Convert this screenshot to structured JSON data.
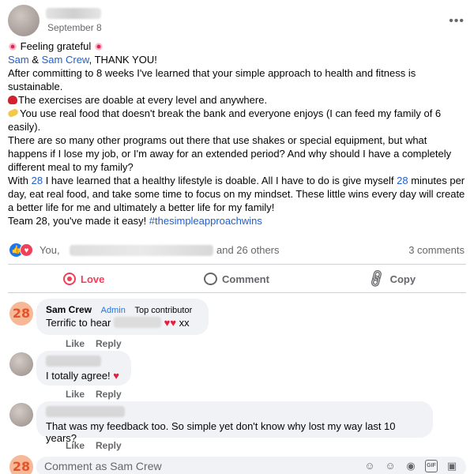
{
  "post": {
    "date": "September 8",
    "more_icon": "more-horizontal-icon",
    "lines": {
      "l1": "Feeling grateful",
      "l2_mention1": "Sam",
      "l2_amp": " & ",
      "l2_mention2": "Sam Crew",
      "l2_rest": ", THANK YOU!",
      "l3": "After committing to 8 weeks I've learned that your simple approach to health and fitness is sustainable.",
      "l4": "The exercises are doable at every level and anywhere.",
      "l5": "You use real food that doesn't break the bank and everyone enjoys (I can feed my family of 6 easily).",
      "l6": "There are so many other programs out there that use shakes or special equipment, but what happens if I lose my job, or I'm away for an extended period?  And why should I have a completely different meal to my family?",
      "l7_a": "With ",
      "l7_link": "28",
      "l7_b": " I have learned that a healthy lifestyle is doable.  All I have to do is give myself ",
      "l7_link2": "28",
      "l7_c": " minutes per day, eat real food, and take some time to focus on my mindset.  These little wins every day will create a better life for me and ultimately a better life for my family!",
      "l8_a": "Team 28, you've made it easy!  ",
      "l8_hashtag": "#thesimpleapproachwins"
    }
  },
  "reactions": {
    "you": "You,",
    "others": "and 26 others",
    "comments_count": "3 comments"
  },
  "actions": {
    "love": "Love",
    "comment": "Comment",
    "copy": "Copy"
  },
  "comments": [
    {
      "author": "Sam Crew",
      "role": "Admin",
      "badge": "Top contributor",
      "text_before": "Terrific to hear",
      "text_after": " xx",
      "hearts": "♥♥",
      "avatar_text": "28",
      "like": "Like",
      "reply": "Reply"
    },
    {
      "text": "I totally agree!",
      "heart": "♥",
      "like": "Like",
      "reply": "Reply"
    },
    {
      "text": "That was my feedback too. So simple yet don't know why lost my way last 10 years?",
      "like": "Like",
      "reply": "Reply"
    }
  ],
  "composer": {
    "avatar_text": "28",
    "placeholder": "Comment as Sam Crew"
  },
  "colors": {
    "link": "#1f5fcf",
    "love": "#f33e58",
    "like_blue": "#1877f2",
    "bubble_bg": "#f0f2f5",
    "muted": "#65676b"
  }
}
